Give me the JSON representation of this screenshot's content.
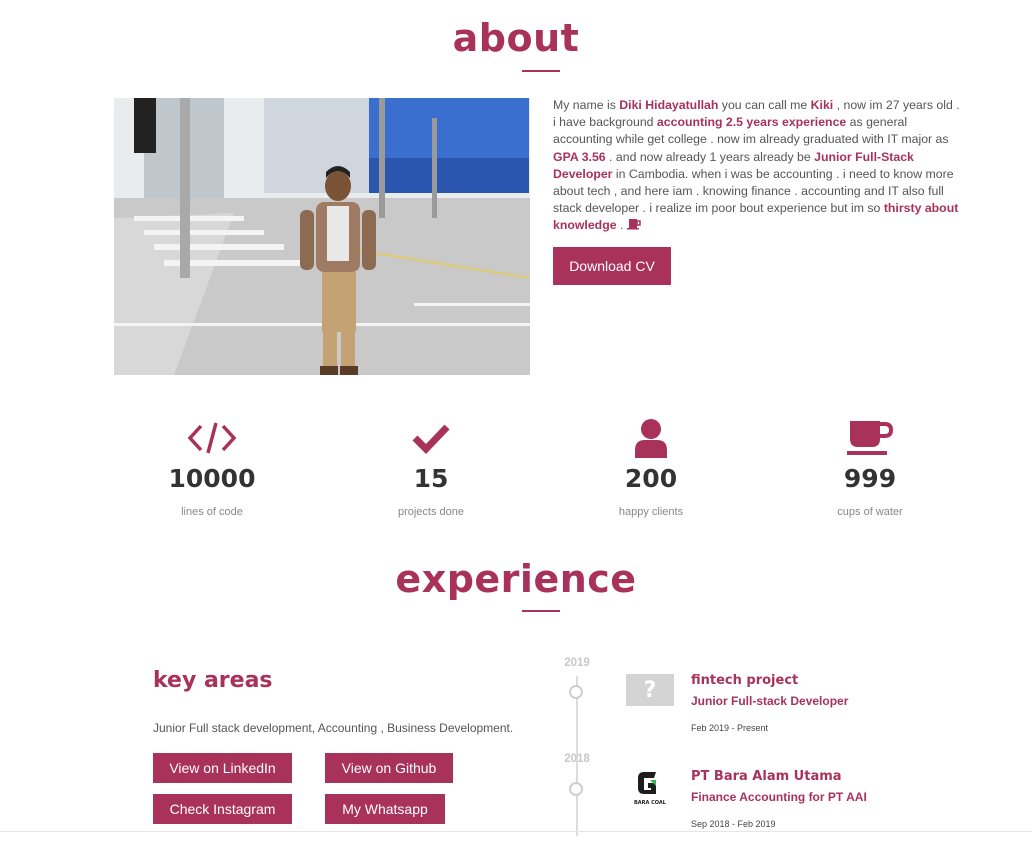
{
  "about": {
    "title": "about",
    "text": {
      "p1": "My name is ",
      "name": "Diki Hidayatullah",
      "p2": " you can call me ",
      "nick": "Kiki",
      "p3": " , now im 27 years old . i have background ",
      "exp": "accounting 2.5 years experience",
      "p4": " as general accounting while get college . now im already graduated with IT major as ",
      "gpa": "GPA 3.56",
      "p5": " . and now already 1 years already be ",
      "role": "Junior Full-Stack Developer",
      "p6": " in Cambodia. when i was be accounting . i need to know more about tech , and here iam . knowing finance . accounting and IT also full stack developer . i realize im poor bout experience but im so ",
      "thirsty": "thirsty about knowledge",
      "p7": " ."
    },
    "download_cv": "Download CV"
  },
  "stats": [
    {
      "icon": "code-icon",
      "number": "10000",
      "label": "lines of code"
    },
    {
      "icon": "check-icon",
      "number": "15",
      "label": "projects done"
    },
    {
      "icon": "user-icon",
      "number": "200",
      "label": "happy clients"
    },
    {
      "icon": "coffee-cup-icon",
      "number": "999",
      "label": "cups of water"
    }
  ],
  "experience": {
    "title": "experience",
    "key_areas": {
      "title": "key areas",
      "text": "Junior Full stack development, Accounting , Business Development.",
      "buttons": {
        "linkedin": "View on LinkedIn",
        "github": "View on Github",
        "instagram": "Check Instagram",
        "whatsapp": "My Whatsapp"
      }
    },
    "timeline": [
      {
        "year": "2019",
        "title": "fintech project",
        "role": "Junior Full-stack Developer",
        "date": "Feb 2019 - Present",
        "logo": "placeholder-question-icon"
      },
      {
        "year": "2018",
        "title": "PT Bara Alam Utama",
        "role": "Finance Accounting for PT AAI",
        "date": "Sep 2018 - Feb 2019",
        "logo": "bara-coal-logo",
        "logo_text": "BARA COAL"
      }
    ]
  },
  "colors": {
    "accent": "#a8325a",
    "text": "#555555",
    "timeline": "#cfcfcf"
  }
}
